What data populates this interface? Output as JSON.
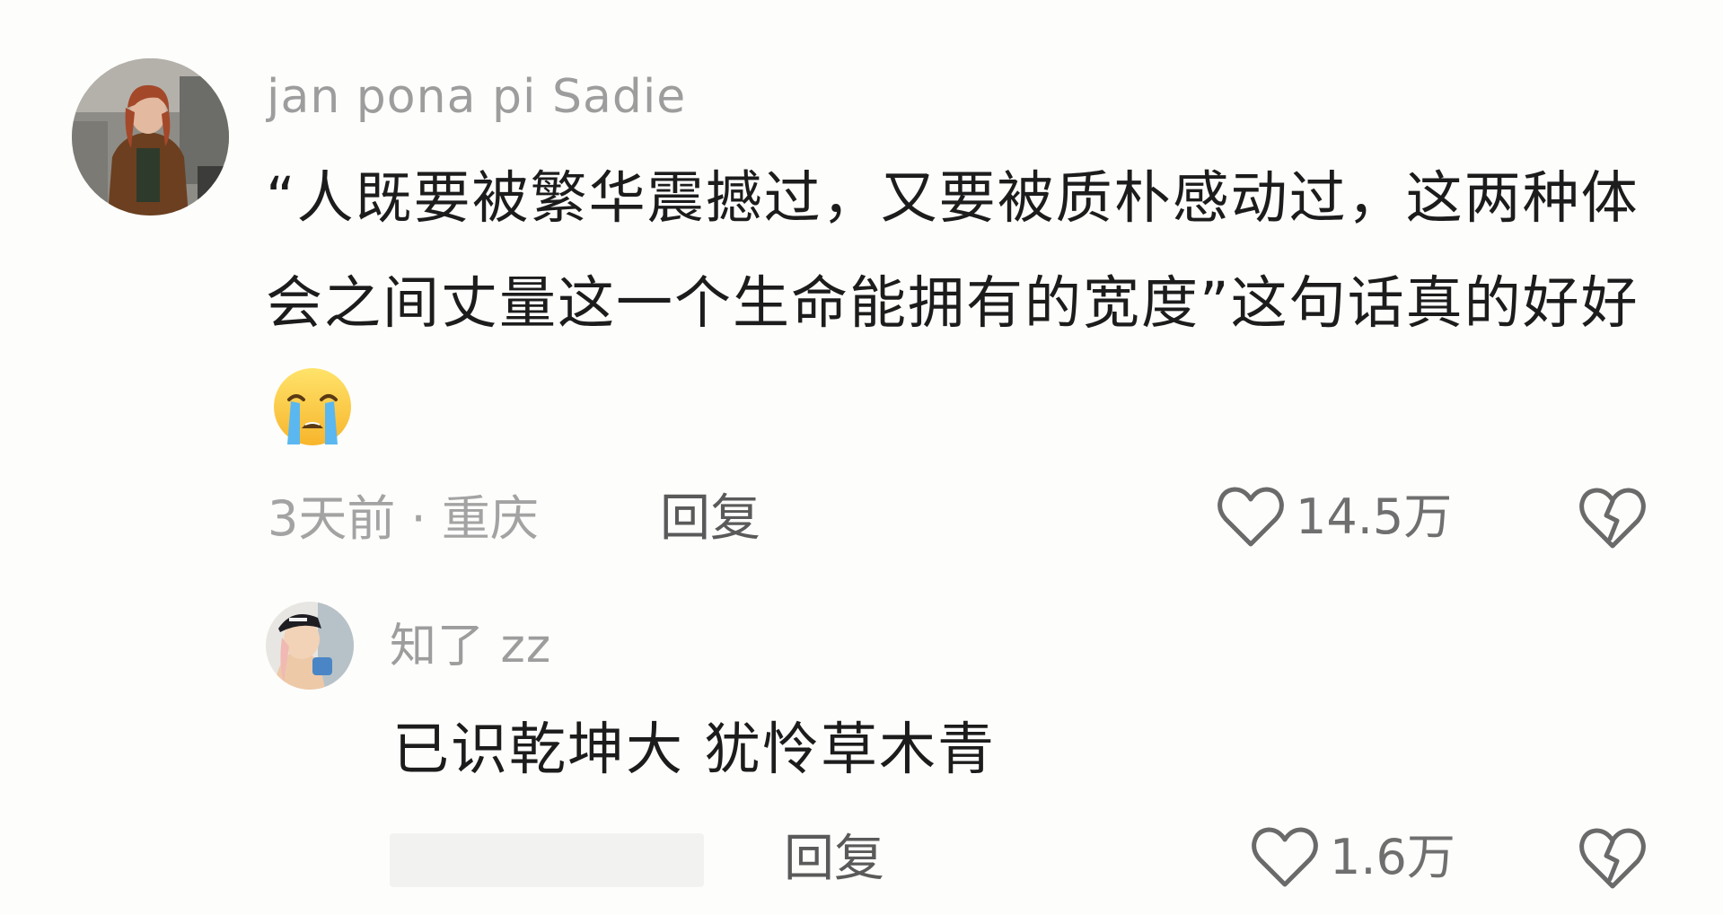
{
  "comment": {
    "username": "jan pona pi Sadie",
    "text": "“人既要被繁华震撼过，又要被质朴感动过，这两种体会之间丈量这一个生命能拥有的宽度”这句话真的好好",
    "emoji": "loudly-crying-face",
    "meta": "3天前 · 重庆",
    "reply_label": "回复",
    "like_count": "14.5万",
    "like_icon": "heart-outline-icon",
    "dislike_icon": "broken-heart-icon"
  },
  "reply": {
    "username": "知了 zz",
    "text": "已识乾坤大 犹怜草木青",
    "reply_label": "回复",
    "like_count": "1.6万",
    "like_icon": "heart-outline-icon",
    "dislike_icon": "broken-heart-icon"
  }
}
